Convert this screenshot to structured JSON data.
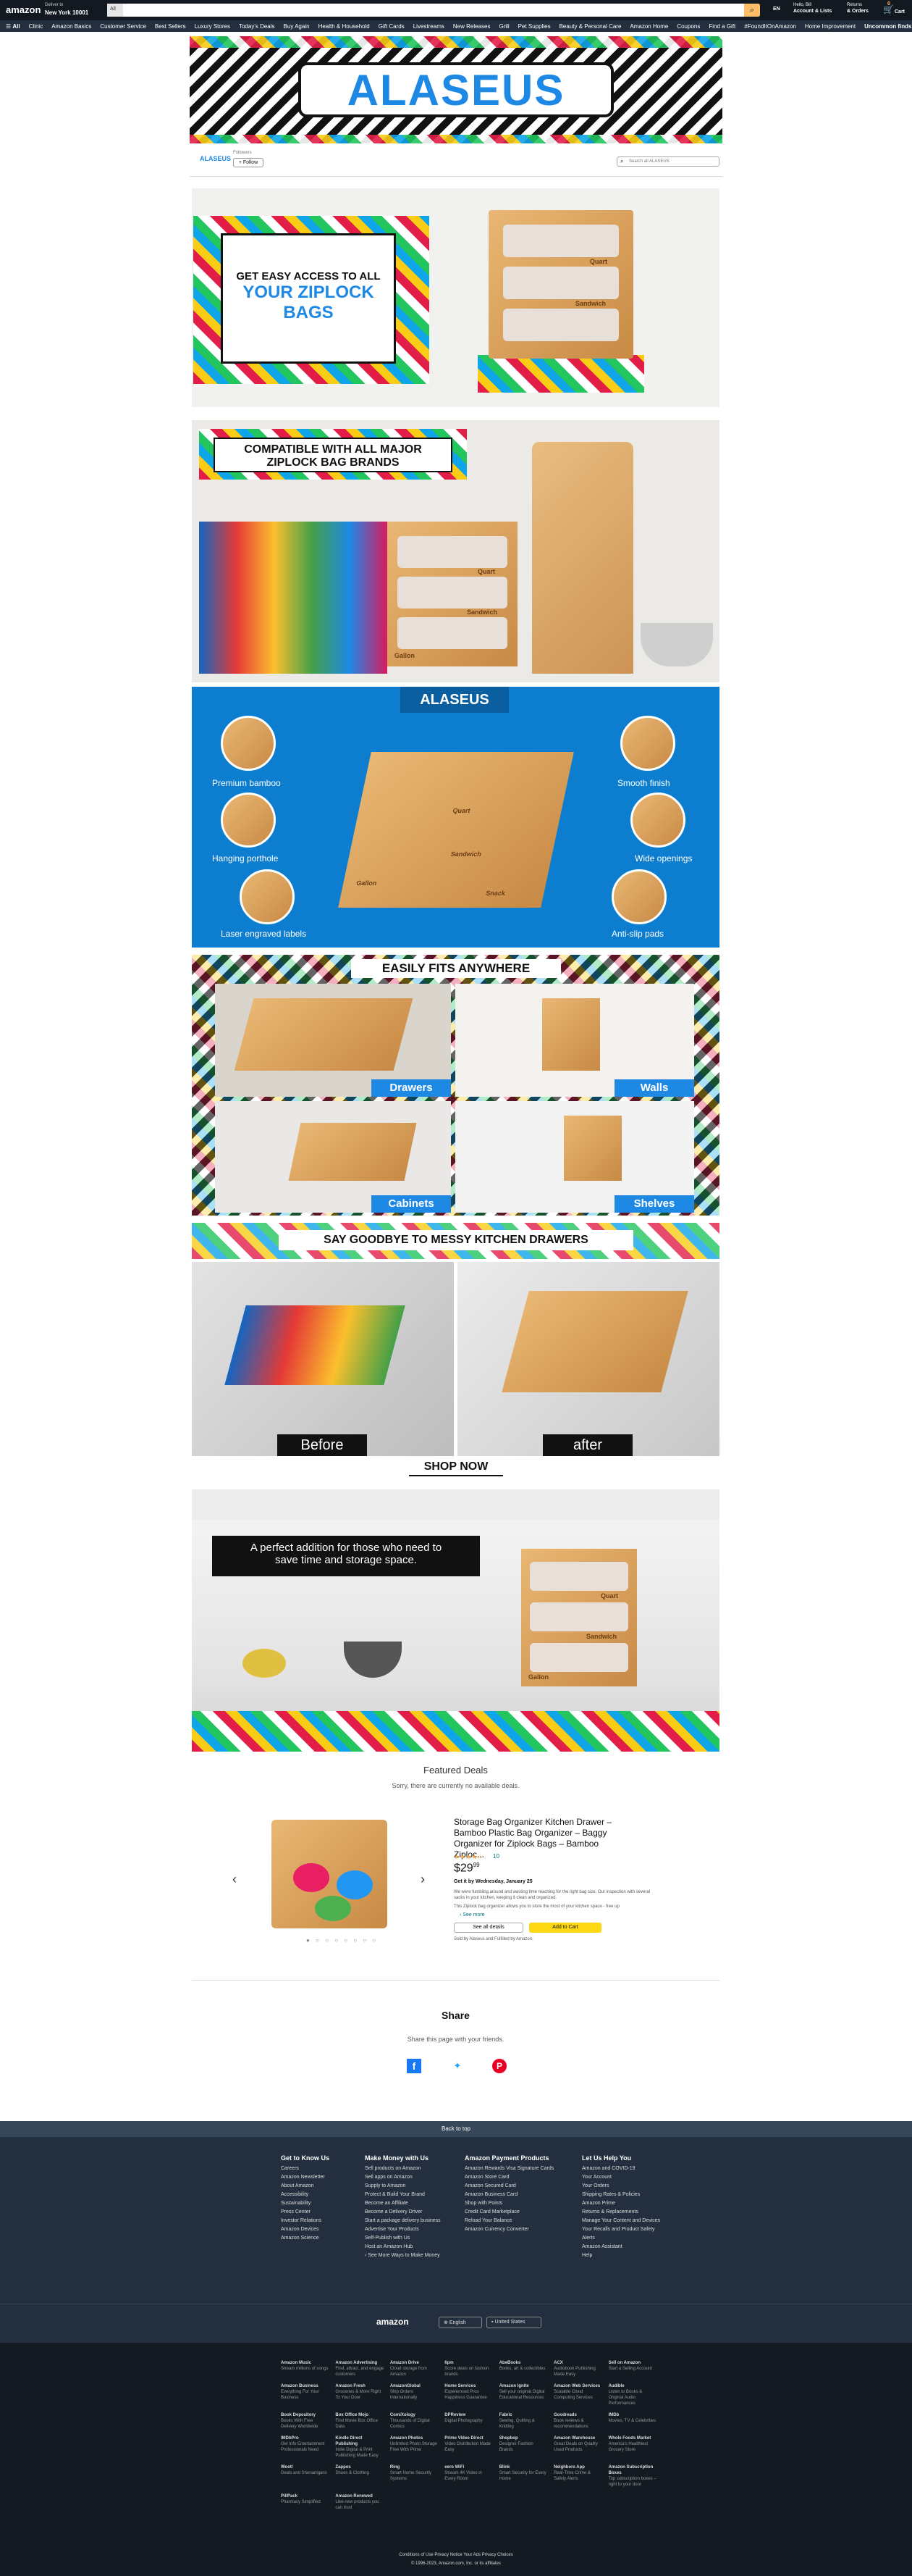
{
  "header": {
    "logo": "amazon",
    "deliver_line1": "Deliver to",
    "deliver_line2": "New York 10001",
    "search_category": "All",
    "lang": "EN",
    "account_line1": "Hello, Bill",
    "account_line2": "Account & Lists",
    "orders_line1": "Returns",
    "orders_line2": "& Orders",
    "cart_label": "Cart",
    "cart_count": "0"
  },
  "subnav": {
    "all": "All",
    "items": [
      "Clinic",
      "Amazon Basics",
      "Customer Service",
      "Best Sellers",
      "Luxury Stores",
      "Today's Deals",
      "Buy Again",
      "Health & Household",
      "Gift Cards",
      "Livestreams",
      "New Releases",
      "Grill",
      "Pet Supplies",
      "Beauty & Personal Care",
      "Amazon Home",
      "Coupons",
      "Find a Gift",
      "#FoundItOnAmazon",
      "Home Improvement"
    ],
    "promo": "Uncommon finds for the year"
  },
  "brand": {
    "banner": "ALASEUS",
    "logo": "ALASEUS",
    "followers": "Followers",
    "follow": "+ Follow",
    "search_placeholder": "Search all ALASEUS"
  },
  "hero": {
    "line1": "GET EASY ACCESS TO ALL",
    "line2": "YOUR ZIPLOCK",
    "line3": "BAGS"
  },
  "compat": {
    "title1": "COMPATIBLE WITH ALL MAJOR",
    "title2": "ZIPLOCK BAG BRANDS"
  },
  "features": {
    "logo": "ALASEUS",
    "items": [
      "Premium bamboo",
      "Hanging porthole",
      "Laser engraved labels",
      "Smooth finish",
      "Wide openings",
      "Anti-slip pads"
    ]
  },
  "fits": {
    "title": "EASILY FITS ANYWHERE",
    "labels": [
      "Drawers",
      "Walls",
      "Cabinets",
      "Shelves"
    ]
  },
  "goodbye": {
    "title": "SAY GOODBYE TO MESSY KITCHEN DRAWERS",
    "before": "Before",
    "after": "after"
  },
  "box_labels": {
    "quart": "Quart",
    "sandwich": "Sandwich",
    "gallon": "Gallon",
    "snack": "Snack"
  },
  "shop_now": "SHOP NOW",
  "perfect": {
    "line1": "A perfect addition for those who need to",
    "line2": "save time and storage space."
  },
  "deals": {
    "title": "Featured Deals",
    "sub": "Sorry, there are currently no available deals.",
    "product_title": "Storage Bag Organizer Kitchen Drawer – Bamboo Plastic Bag Organizer – Baggy Organizer for Ziplock Bags – Bamboo Ziploc...",
    "stars": "★★★★☆",
    "reviews": "10",
    "price": "$29",
    "price_cents": "99",
    "delivery": "Get it by Wednesday, January 25",
    "bullet1": "We were fumbling around and wasting time reaching for the right bag size. Our inspection with several sacks in your kitchen, keeping it clean and organized.",
    "bullet2": "This Ziplock bag organizer allows you to store the most of your kitchen space - free up",
    "see_more": "› See more",
    "see_details": "See all details",
    "add_to_cart": "Add to Cart",
    "sold_by": "Sold by Alaseus and Fulfilled by Amazon."
  },
  "share": {
    "title": "Share",
    "sub": "Share this page with your friends."
  },
  "footer": {
    "back_to_top": "Back to top",
    "cols": [
      {
        "title": "Get to Know Us",
        "items": [
          "Careers",
          "Amazon Newsletter",
          "About Amazon",
          "Accessibility",
          "Sustainability",
          "Press Center",
          "Investor Relations",
          "Amazon Devices",
          "Amazon Science"
        ]
      },
      {
        "title": "Make Money with Us",
        "items": [
          "Sell products on Amazon",
          "Sell apps on Amazon",
          "Supply to Amazon",
          "Protect & Build Your Brand",
          "Become an Affiliate",
          "Become a Delivery Driver",
          "Start a package delivery business",
          "Advertise Your Products",
          "Self-Publish with Us",
          "Host an Amazon Hub",
          "› See More Ways to Make Money"
        ]
      },
      {
        "title": "Amazon Payment Products",
        "items": [
          "Amazon Rewards Visa Signature Cards",
          "Amazon Store Card",
          "Amazon Secured Card",
          "Amazon Business Card",
          "Shop with Points",
          "Credit Card Marketplace",
          "Reload Your Balance",
          "Amazon Currency Converter"
        ]
      },
      {
        "title": "Let Us Help You",
        "items": [
          "Amazon and COVID-19",
          "Your Account",
          "Your Orders",
          "Shipping Rates & Policies",
          "Amazon Prime",
          "Returns & Replacements",
          "Manage Your Content and Devices",
          "Your Recalls and Product Safety Alerts",
          "Amazon Assistant",
          "Help"
        ]
      }
    ],
    "logo": "amazon",
    "lang": "English",
    "country": "United States",
    "bottom": [
      [
        "Amazon Music",
        "Stream millions of songs"
      ],
      [
        "Amazon Advertising",
        "Find, attract, and engage customers"
      ],
      [
        "Amazon Drive",
        "Cloud storage from Amazon"
      ],
      [
        "6pm",
        "Score deals on fashion brands"
      ],
      [
        "AbeBooks",
        "Books, art & collectibles"
      ],
      [
        "ACX",
        "Audiobook Publishing Made Easy"
      ],
      [
        "Sell on Amazon",
        "Start a Selling Account"
      ],
      [
        "Amazon Business",
        "Everything For Your Business"
      ],
      [
        "Amazon Fresh",
        "Groceries & More Right To Your Door"
      ],
      [
        "AmazonGlobal",
        "Ship Orders Internationally"
      ],
      [
        "Home Services",
        "Experienced Pros Happiness Guarantee"
      ],
      [
        "Amazon Ignite",
        "Sell your original Digital Educational Resources"
      ],
      [
        "Amazon Web Services",
        "Scalable Cloud Computing Services"
      ],
      [
        "Audible",
        "Listen to Books & Original Audio Performances"
      ],
      [
        "Book Depository",
        "Books With Free Delivery Worldwide"
      ],
      [
        "Box Office Mojo",
        "Find Movie Box Office Data"
      ],
      [
        "ComiXology",
        "Thousands of Digital Comics"
      ],
      [
        "DPReview",
        "Digital Photography"
      ],
      [
        "Fabric",
        "Sewing, Quilting & Knitting"
      ],
      [
        "Goodreads",
        "Book reviews & recommendations"
      ],
      [
        "IMDb",
        "Movies, TV & Celebrities"
      ],
      [
        "IMDbPro",
        "Get Info Entertainment Professionals Need"
      ],
      [
        "Kindle Direct Publishing",
        "Indie Digital & Print Publishing Made Easy"
      ],
      [
        "Amazon Photos",
        "Unlimited Photo Storage Free With Prime"
      ],
      [
        "Prime Video Direct",
        "Video Distribution Made Easy"
      ],
      [
        "Shopbop",
        "Designer Fashion Brands"
      ],
      [
        "Amazon Warehouse",
        "Great Deals on Quality Used Products"
      ],
      [
        "Whole Foods Market",
        "America's Healthiest Grocery Store"
      ],
      [
        "Woot!",
        "Deals and Shenanigans"
      ],
      [
        "Zappos",
        "Shoes & Clothing"
      ],
      [
        "Ring",
        "Smart Home Security Systems"
      ],
      [
        "eero WiFi",
        "Stream 4K Video in Every Room"
      ],
      [
        "Blink",
        "Smart Security for Every Home"
      ],
      [
        "Neighbors App",
        "Real-Time Crime & Safety Alerts"
      ],
      [
        "Amazon Subscription Boxes",
        "Top subscription boxes – right to your door"
      ],
      [
        "PillPack",
        "Pharmacy Simplified"
      ],
      [
        "Amazon Renewed",
        "Like-new products you can trust"
      ]
    ],
    "legal1": "Conditions of Use    Privacy Notice    Your Ads Privacy Choices",
    "legal2": "© 1996-2023, Amazon.com, Inc. or its affiliates"
  },
  "colors": {
    "nav": "#131921",
    "subnav": "#232f3e",
    "accent": "#febd69",
    "blue": "#1e88e5",
    "footer_mid": "#232f3e",
    "footer_bottom": "#131a22"
  }
}
